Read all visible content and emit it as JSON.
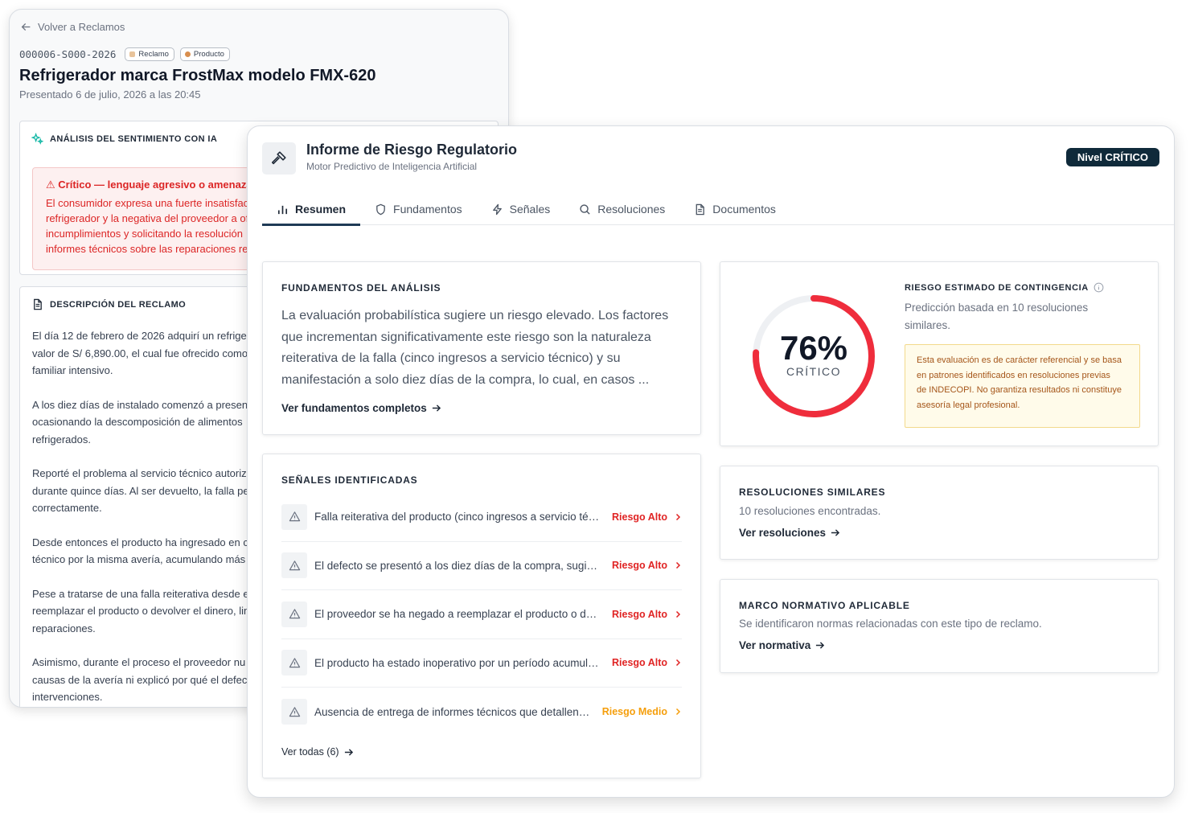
{
  "back": {
    "back_link": "Volver a Reclamos",
    "case_code": "000006-S000-2026",
    "chips": {
      "reclamo": "Reclamo",
      "producto": "Producto"
    },
    "title": "Refrigerador marca FrostMax modelo FMX-620",
    "submitted": "Presentado 6 de julio, 2026 a las 20:45",
    "sentiment": {
      "heading": "ANÁLISIS DEL SENTIMIENTO CON IA",
      "alert_title": "⚠ Crítico — lenguaje agresivo o amenaza le",
      "alert_lines": [
        "El consumidor expresa una fuerte insatisfac",
        "refrigerador y la negativa del proveedor a of",
        "incumplimientos y solicitando la resolución",
        "informes técnicos sobre las reparaciones re"
      ]
    },
    "description": {
      "heading": "DESCRIPCIÓN DEL RECLAMO",
      "paragraphs": [
        "El día 12 de febrero de 2026 adquirí un refriger\nvalor de S/ 6,890.00, el cual fue ofrecido como\nfamiliar intensivo.",
        "A los diez días de instalado comenzó a presen\nocasionando la descomposición de alimentos\nrefrigerados.",
        "Reporté el problema al servicio técnico autoriz\ndurante quince días. Al ser devuelto, la falla pe\ncorrectamente.",
        "Desde entonces el producto ha ingresado en c\ntécnico por la misma avería, acumulando más",
        "Pese a tratarse de una falla reiterativa desde e\nreemplazar el producto o devolver el dinero, lin\nreparaciones.",
        "Asimismo, durante el proceso el proveedor nu\ncausas de la avería ni explicó por qué el defec\nintervenciones."
      ]
    }
  },
  "report": {
    "title": "Informe de Riesgo Regulatorio",
    "subtitle": "Motor Predictivo de Inteligencia Artificial",
    "level_badge": "Nivel CRÍTICO",
    "tabs": [
      "Resumen",
      "Fundamentos",
      "Señales",
      "Resoluciones",
      "Documentos"
    ],
    "fundamentos": {
      "title": "FUNDAMENTOS DEL ANÁLISIS",
      "lines": [
        "La evaluación probabilística sugiere un riesgo elevado. Los factores",
        "que incrementan significativamente este riesgo son la naturaleza",
        "reiterativa de la falla (cinco ingresos a servicio técnico) y su",
        "manifestación a solo diez días de la compra, lo cual, en casos ..."
      ],
      "link": "Ver fundamentos completos"
    },
    "signals": {
      "title": "SEÑALES IDENTIFICADAS",
      "items": [
        {
          "text": "Falla reiterativa del producto (cinco ingresos a servicio técnico)",
          "risk": "Riesgo Alto"
        },
        {
          "text": "El defecto se presentó a los diez días de la compra, sugiriendo",
          "risk": "Riesgo Alto"
        },
        {
          "text": "El proveedor se ha negado a reemplazar el producto o devolver",
          "risk": "Riesgo Alto"
        },
        {
          "text": "El producto ha estado inoperativo por un período acumulado",
          "risk": "Riesgo Alto"
        },
        {
          "text": "Ausencia de entrega de informes técnicos que detallen las causas",
          "risk": "Riesgo Medio"
        }
      ],
      "link": "Ver todas (6)"
    },
    "risk": {
      "percent_value": 76,
      "percent": "76%",
      "label": "CRÍTICO",
      "title": "RIESGO ESTIMADO DE CONTINGENCIA",
      "prediction": "Predicción basada en 10 resoluciones\nsimilares.",
      "disclaimer_lines": [
        "Esta evaluación es de carácter referencial y se basa",
        "en patrones identificados en resoluciones previas",
        "de INDECOPI. No garantiza resultados ni constituye",
        "asesoría legal profesional."
      ]
    },
    "similares": {
      "title": "RESOLUCIONES SIMILARES",
      "desc": "10 resoluciones encontradas.",
      "link": "Ver resoluciones"
    },
    "normativa": {
      "title": "MARCO NORMATIVO APLICABLE",
      "desc": "Se identificaron normas relacionadas con este tipo de reclamo.",
      "link": "Ver normativa"
    }
  },
  "colors": {
    "high_risk": "#e02424",
    "medium_risk": "#f59e0b",
    "gauge_fill": "#ef2d3c",
    "gauge_track": "#eef0f3",
    "badge_bg": "#0f2a3a"
  },
  "icons": [
    "arrow-left-icon",
    "sparkle-icon",
    "document-icon",
    "gavel-icon",
    "bar-chart-icon",
    "shield-icon",
    "lightning-icon",
    "search-icon",
    "file-text-icon",
    "warning-triangle-icon",
    "chevron-right-icon",
    "arrow-right-icon",
    "info-icon"
  ]
}
